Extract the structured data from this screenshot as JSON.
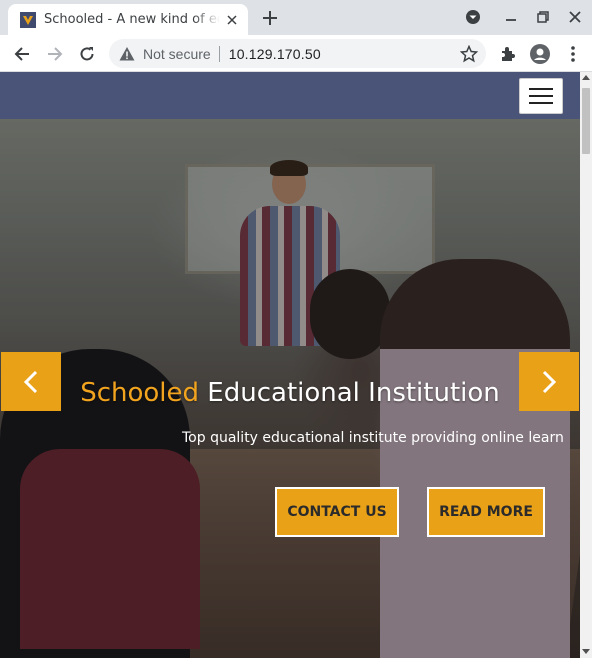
{
  "browser": {
    "tab": {
      "title": "Schooled - A new kind of educational institute",
      "favicon": "schooled-favicon-icon"
    },
    "omnibox": {
      "security_label": "Not secure",
      "url": "10.129.170.50"
    },
    "colors": {
      "tabstrip": "#dee1e6",
      "omnibox": "#f1f3f4"
    }
  },
  "site": {
    "hero": {
      "title_accent": "Schooled",
      "title_rest": " Educational Institution",
      "subtitle": "Top quality educational institute providing online learn",
      "buttons": {
        "contact": "CONTACT US",
        "read_more": "READ MORE"
      }
    },
    "colors": {
      "accent": "#e9a118",
      "header": "#4a5478"
    }
  }
}
